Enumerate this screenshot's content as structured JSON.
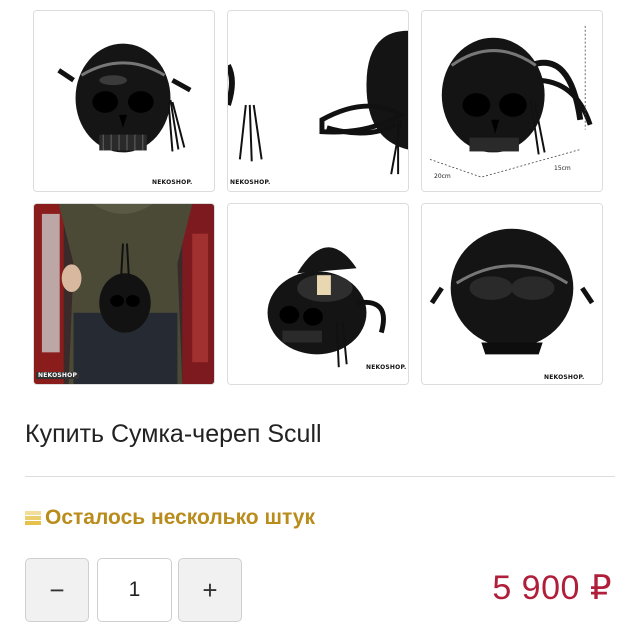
{
  "gallery": {
    "thumbnails": [
      {
        "label": "skull-bag-front-view",
        "watermark": "NEKOSHOP."
      },
      {
        "label": "skull-bag-strap-view",
        "watermark": "NEKOSHOP."
      },
      {
        "label": "skull-bag-dimensions-view",
        "dim_width": "20cm",
        "dim_depth": "15cm"
      },
      {
        "label": "skull-bag-worn-photo",
        "watermark": "NEKOSHOP"
      },
      {
        "label": "skull-bag-open-view",
        "watermark": "NEKOSHOP."
      },
      {
        "label": "skull-bag-back-view",
        "watermark": "NEKOSHOP."
      }
    ]
  },
  "product": {
    "title": "Купить Сумка-череп Scull",
    "stock_text": "Осталось несколько штук",
    "price": "5 900 ₽"
  },
  "quantity": {
    "minus_label": "−",
    "value": "1",
    "plus_label": "+"
  },
  "colors": {
    "stock": "#b98c1c",
    "price": "#b01f3a"
  }
}
